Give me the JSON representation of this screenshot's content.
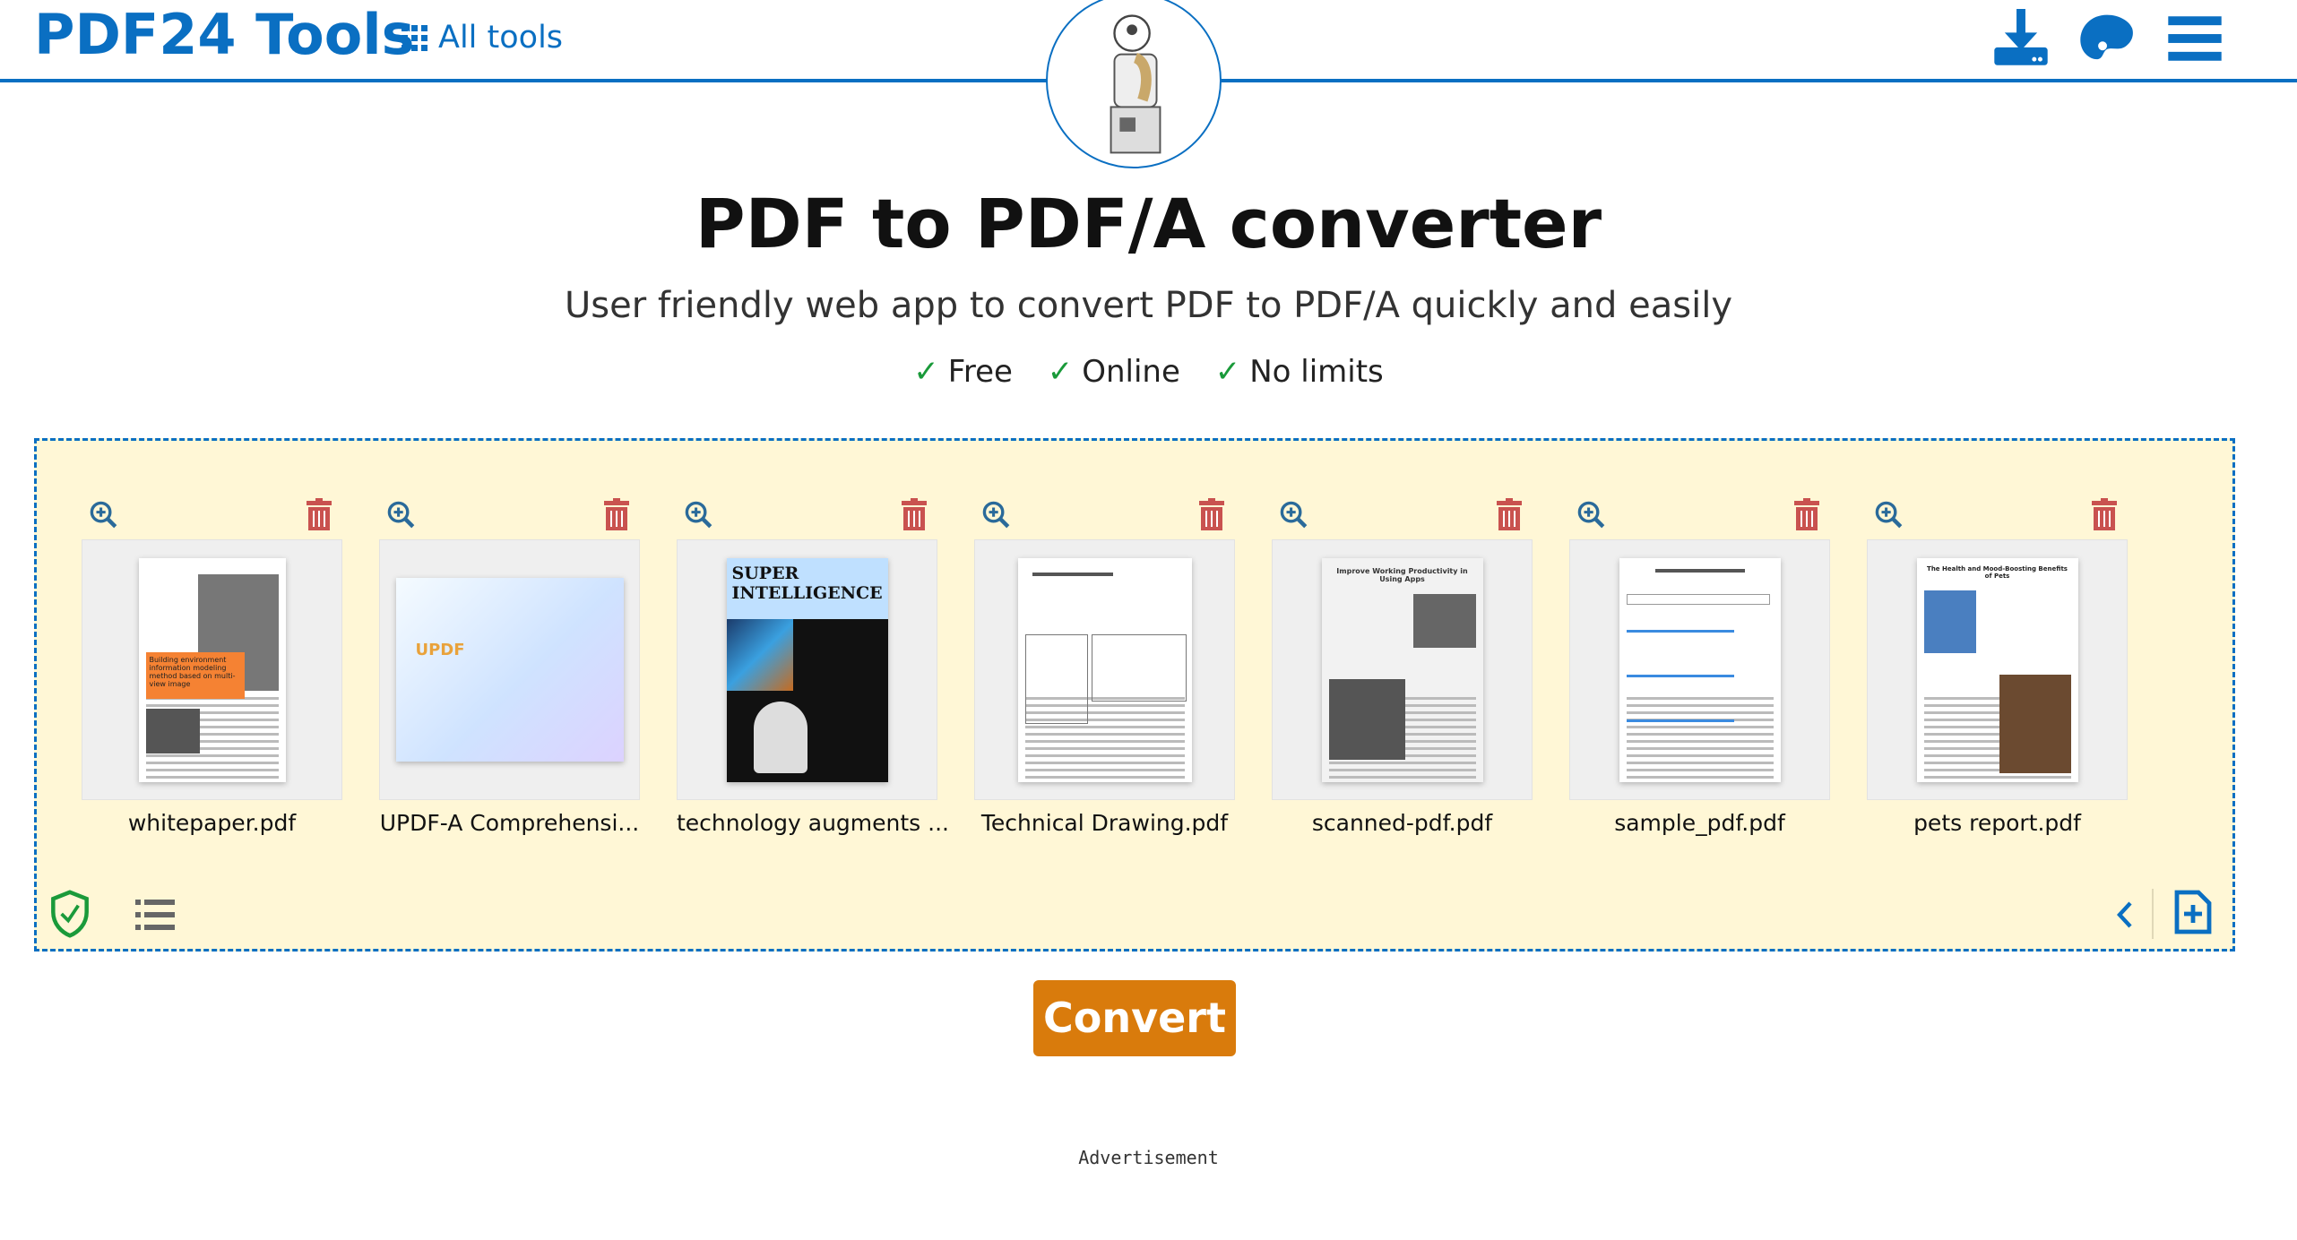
{
  "header": {
    "logo": "PDF24 Tools",
    "all_tools": "All tools",
    "icons": [
      "download-icon",
      "palette-icon",
      "menu-icon"
    ]
  },
  "title": "PDF to PDF/A converter",
  "subtitle": "User friendly web app to convert PDF to PDF/A quickly and easily",
  "features": [
    "Free",
    "Online",
    "No limits"
  ],
  "files": [
    {
      "name": "whitepaper.pdf",
      "heading": "Building environment information modeling method based on multi-view image"
    },
    {
      "name": "UPDF-A Comprehensi...",
      "heading": "UPDF"
    },
    {
      "name": "technology augments ...",
      "heading": "SUPER INTELLIGENCE"
    },
    {
      "name": "Technical Drawing.pdf"
    },
    {
      "name": "scanned-pdf.pdf",
      "heading": "Improve Working Productivity in Using Apps"
    },
    {
      "name": "sample_pdf.pdf"
    },
    {
      "name": "pets report.pdf",
      "heading": "The Health and Mood-Boosting Benefits of Pets"
    }
  ],
  "colors": {
    "brand": "#0a6fc2",
    "convert": "#d97b0c",
    "dropzone": "#fff7d6",
    "trash": "#c9524f",
    "shield": "#1a9a3a"
  },
  "convert_label": "Convert",
  "advertisement": "Advertisement"
}
